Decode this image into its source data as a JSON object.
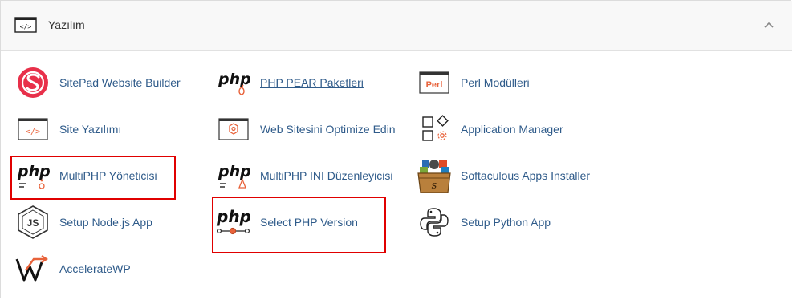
{
  "section": {
    "title": "Yazılım",
    "collapse_icon": "chevron-up-icon"
  },
  "items": [
    {
      "label": "SitePad Website Builder",
      "icon": "sitepad-icon"
    },
    {
      "label": "PHP PEAR Paketleri",
      "icon": "php-pear-icon"
    },
    {
      "label": "Perl Modülleri",
      "icon": "perl-icon",
      "icon_text": "Perl"
    },
    {
      "label": "Site Yazılımı",
      "icon": "site-software-icon"
    },
    {
      "label": "Web Sitesini Optimize Edin",
      "icon": "optimize-icon"
    },
    {
      "label": "Application Manager",
      "icon": "app-manager-icon"
    },
    {
      "label": "MultiPHP Yöneticisi",
      "icon": "multiphp-manager-icon"
    },
    {
      "label": "MultiPHP INI Düzenleyicisi",
      "icon": "multiphp-ini-icon"
    },
    {
      "label": "Softaculous Apps Installer",
      "icon": "softaculous-icon"
    },
    {
      "label": "Setup Node.js App",
      "icon": "nodejs-icon"
    },
    {
      "label": "Select PHP Version",
      "icon": "select-php-icon"
    },
    {
      "label": "Setup Python App",
      "icon": "python-icon"
    },
    {
      "label": "AccelerateWP",
      "icon": "acceleratewp-icon"
    }
  ],
  "php_logo_text": "php",
  "colors": {
    "link": "#2f5b8a",
    "accent": "#e8623a",
    "highlight": "#e00000",
    "sitepad": "#e8304a"
  }
}
